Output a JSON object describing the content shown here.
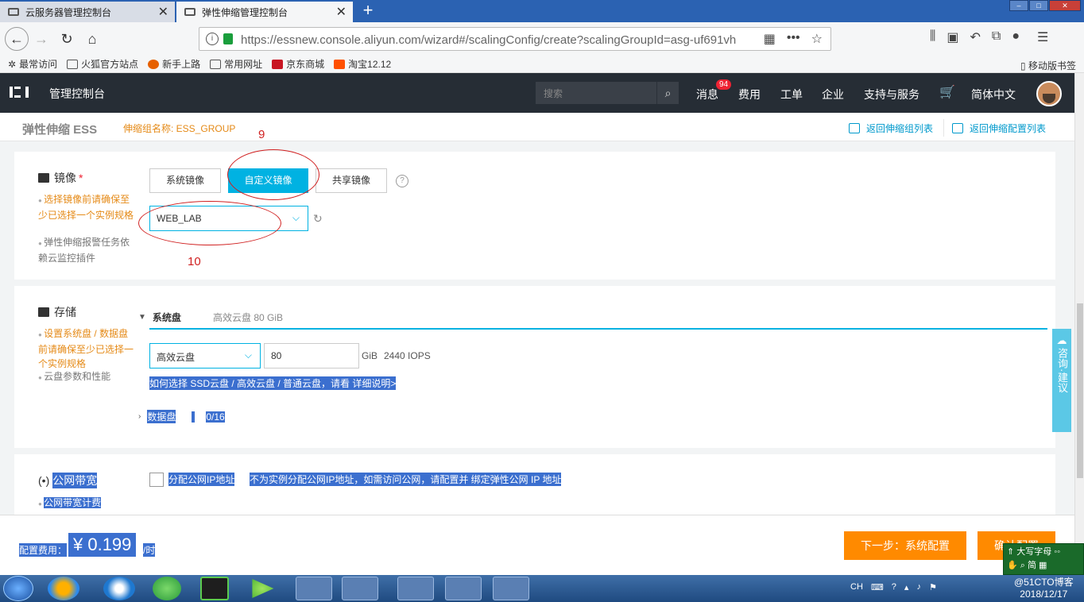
{
  "browser": {
    "tabs": [
      {
        "label": "云服务器管理控制台"
      },
      {
        "label": "弹性伸缩管理控制台"
      }
    ],
    "url": "https://essnew.console.aliyun.com/wizard#/scalingConfig/create?scalingGroupId=asg-uf691vh",
    "bookmarks": [
      "最常访问",
      "火狐官方站点",
      "新手上路",
      "常用网址",
      "京东商城",
      "淘宝12.12"
    ],
    "mobile_bookmarks": "移动版书签"
  },
  "console": {
    "title": "管理控制台",
    "search_placeholder": "搜索",
    "nav": [
      "消息",
      "费用",
      "工单",
      "企业",
      "支持与服务",
      "简体中文"
    ],
    "message_count": "94"
  },
  "subheader": {
    "product": "弹性伸缩 ESS",
    "group": "伸缩组名称: ESS_GROUP",
    "back_groups": "返回伸缩组列表",
    "back_configs": "返回伸缩配置列表"
  },
  "image_section": {
    "title": "镜像",
    "required": "*",
    "note1": "选择镜像前请确保至少已选择一个实例规格",
    "note2": "弹性伸缩报警任务依赖云监控插件",
    "buttons": [
      "系统镜像",
      "自定义镜像",
      "共享镜像"
    ],
    "selected": "WEB_LAB",
    "annotation_a": "9",
    "annotation_b": "10"
  },
  "storage_section": {
    "title": "存储",
    "note1": "设置系统盘 / 数据盘前请确保至少已选择一个实例规格",
    "note2": "云盘参数和性能",
    "system_disk_label": "系统盘",
    "system_disk_info": "高效云盘   80 GiB",
    "disk_type": "高效云盘",
    "disk_size": "80",
    "disk_unit": "GiB",
    "iops": "2440 IOPS",
    "help_link": "如何选择 SSD云盘 / 高效云盘 / 普通云盘，请看 详细说明>",
    "data_disk_label": "数据盘",
    "data_disk_count": "0/16"
  },
  "bandwidth_section": {
    "title": "公网带宽",
    "note": "公网带宽计费",
    "checkbox_label": "分配公网IP地址",
    "description": "不为实例分配公网IP地址，如需访问公网，请配置并 绑定弹性公网 IP 地址"
  },
  "footer": {
    "fee_label": "配置费用：",
    "fee_value": "¥ 0.199",
    "fee_unit": "/时",
    "next_button": "下一步：系统配置",
    "confirm_button": "确认配置"
  },
  "consult": "咨询·建议",
  "ime": {
    "line1": "大写字母",
    "line2": "简"
  },
  "taskbar": {
    "lang": "CH",
    "date": "2018/12/17",
    "watermark": "@51CTO博客"
  }
}
